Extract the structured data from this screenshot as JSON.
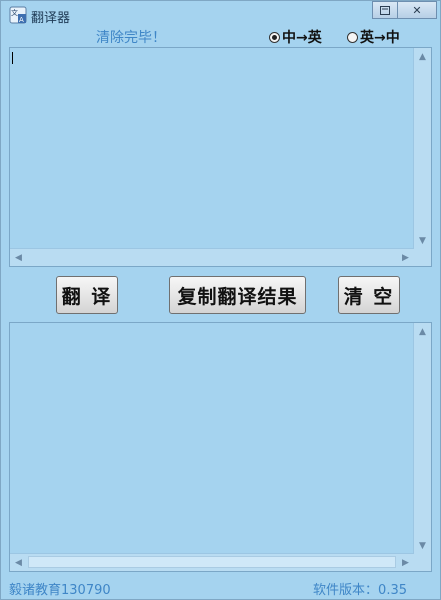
{
  "window": {
    "title": "翻译器",
    "controls": {
      "restore_icon": "restore-icon",
      "close_label": "✕"
    }
  },
  "status_text": "清除完毕！",
  "direction": {
    "options": [
      {
        "label": "中→英",
        "selected": true
      },
      {
        "label": "英→中",
        "selected": false
      }
    ]
  },
  "input_area": {
    "value": ""
  },
  "output_area": {
    "value": ""
  },
  "buttons": {
    "translate": "翻 译",
    "copy": "复制翻译结果",
    "clear": "清 空"
  },
  "footer": {
    "left": "毅诸教育130790",
    "right": "软件版本：0.35"
  },
  "colors": {
    "background": "#a5d3ef",
    "status_text": "#3f86c7"
  }
}
